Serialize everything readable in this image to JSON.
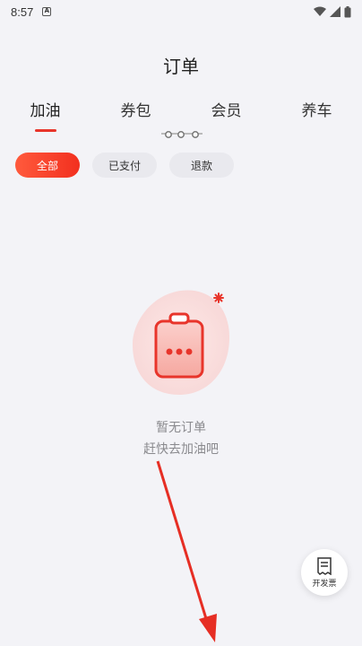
{
  "status_bar": {
    "time": "8:57",
    "notification_glyph": "A"
  },
  "header": {
    "title": "订单"
  },
  "tabs": [
    {
      "label": "加油",
      "active": true
    },
    {
      "label": "券包",
      "active": false
    },
    {
      "label": "会员",
      "active": false
    },
    {
      "label": "养车",
      "active": false
    }
  ],
  "filters": [
    {
      "label": "全部",
      "active": true
    },
    {
      "label": "已支付",
      "active": false
    },
    {
      "label": "退款",
      "active": false
    }
  ],
  "empty_state": {
    "line1": "暂无订单",
    "line2": "赶快去加油吧"
  },
  "invoice_button": {
    "label": "开发票",
    "icon": "receipt-icon"
  },
  "colors": {
    "accent": "#e8352b",
    "background": "#f3f3f7",
    "muted_text": "#8a8a8e"
  }
}
